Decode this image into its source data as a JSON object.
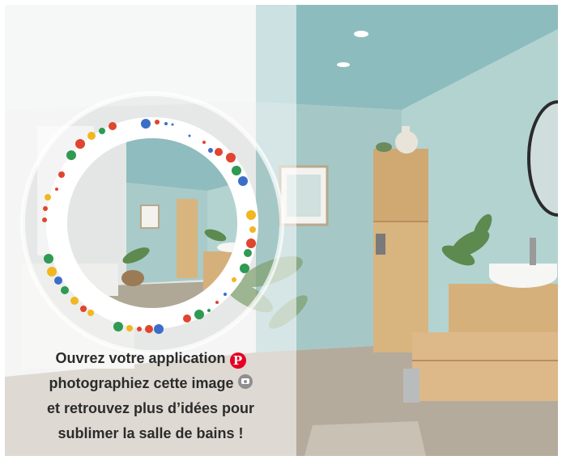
{
  "image": {
    "description_icons": [
      "pinterest-icon",
      "camera-icon"
    ],
    "colors": {
      "wall_blue": "#a9cac8",
      "wood": "#d9b687",
      "lens_red": "#e0452f",
      "lens_yellow": "#f2b620",
      "lens_green": "#2f9a52",
      "lens_blue": "#3a6ec9"
    }
  },
  "caption": {
    "line1": "Ouvrez votre application",
    "line2": "photographiez cette image",
    "line3": "et retrouvez plus d’idées pour",
    "line4": "sublimer la salle de bains !"
  }
}
